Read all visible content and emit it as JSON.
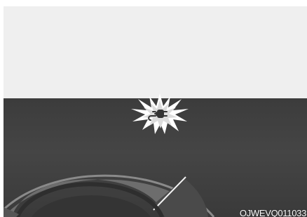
{
  "illustration": {
    "caption": "OJWEVQ011033",
    "icon": "plug-charging-icon",
    "colors": {
      "top_panel": "#efefef",
      "dash_background": "#3e3e3e",
      "gauge_ring": "#6a6a6a",
      "flash": "#ffffff"
    }
  }
}
